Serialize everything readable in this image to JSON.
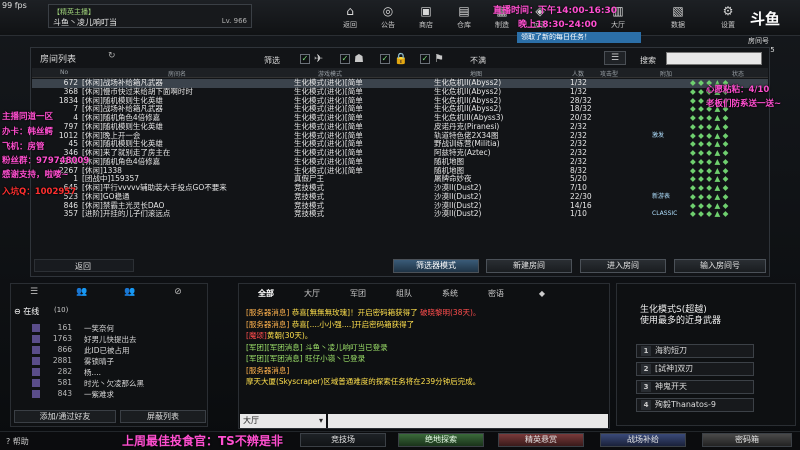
{
  "fps": "99 fps",
  "player": {
    "tag": "【精英主播】",
    "name": "斗鱼丶凌儿响叮当",
    "level": "Lv. 966"
  },
  "topnav": [
    {
      "label": "返回",
      "icon": "⌂"
    },
    {
      "label": "公告",
      "icon": "◎"
    },
    {
      "label": "商店",
      "icon": "▣"
    },
    {
      "label": "仓库",
      "icon": "▤"
    },
    {
      "label": "制造",
      "icon": "▦"
    },
    {
      "label": "运营",
      "icon": "◈"
    },
    {
      "label": "大厅",
      "icon": "▥"
    },
    {
      "label": "数据",
      "icon": "▧"
    },
    {
      "label": "设置",
      "icon": "⚙"
    }
  ],
  "stream_time_1": "直播时间：下午14:00-16:30",
  "stream_time_2": "晚上18:30-24:00",
  "mission": "领取了新的每日任务！",
  "logo": "斗鱼",
  "room_no_label": "房间号",
  "room_no": "209445",
  "room_list": {
    "title": "房间列表",
    "filter_label": "筛选",
    "full_label": "不满",
    "search_label": "搜索",
    "search_placeholder": "",
    "headers": {
      "no": "No",
      "name": "房间名",
      "mode": "游戏模式",
      "map": "地图",
      "count": "人数",
      "ping": "攻击型",
      "flag": "附加",
      "status": "状态"
    },
    "rows": [
      {
        "no": "672",
        "name": "[休闲]战场补给箱凡武器",
        "mode": "生化模式(进化)[简单",
        "map": "生化危机II(Abyss2)",
        "count": "1/32",
        "selected": true,
        "badge": ""
      },
      {
        "no": "368",
        "name": "[休闲]慢币快过来给胡下面啊时时",
        "mode": "生化模式(进化)[简单",
        "map": "生化危机II(Abyss2)",
        "count": "1/32",
        "badge": ""
      },
      {
        "no": "1834",
        "name": "[休闲]随机模则生化英雄",
        "mode": "生化模式(进化)[简单",
        "map": "生化危机II(Abyss2)",
        "count": "28/32",
        "badge": ""
      },
      {
        "no": "7",
        "name": "[休闲]战场补给箱凡武器",
        "mode": "生化模式(进化)[简单",
        "map": "生化危机II(Abyss2)",
        "count": "18/32",
        "badge": ""
      },
      {
        "no": "4",
        "name": "[休闲]随机角色4倍修嘉",
        "mode": "生化模式(进化)[简单",
        "map": "生化危机III(Abyss3)",
        "count": "20/32",
        "badge": ""
      },
      {
        "no": "797",
        "name": "[休闲]随机模则生化英雄",
        "mode": "生化模式(进化)[简单",
        "map": "皮诺丹克(Piranesi)",
        "count": "2/32",
        "badge": ""
      },
      {
        "no": "1012",
        "name": "[休闲]晚上开一会",
        "mode": "生化模式(进化)[简单",
        "map": "轨道特色佬2X34图",
        "count": "2/32",
        "badge": "激发"
      },
      {
        "no": "45",
        "name": "[休闲]随机模则生化英雄",
        "mode": "生化模式(进化)[简单",
        "map": "野战训练营(Militia)",
        "count": "2/32",
        "badge": ""
      },
      {
        "no": "346",
        "name": "[休闲]来了就别走了房主在",
        "mode": "生化模式(进化)[简单",
        "map": "阿兹特克(Aztec)",
        "count": "2/32",
        "badge": ""
      },
      {
        "no": "1145",
        "name": "[休闲]随机角色4倍修嘉",
        "mode": "生化模式(进化)[简单",
        "map": "随机地图",
        "count": "2/32",
        "badge": ""
      },
      {
        "no": "2267",
        "name": "[休闲]1338",
        "mode": "生化模式(进化)[简单",
        "map": "随机地图",
        "count": "8/32",
        "badge": ""
      },
      {
        "no": "1",
        "name": "[团战中]159357",
        "mode": "真假尸王",
        "map": "屠牌命妙夜",
        "count": "5/20",
        "badge": ""
      },
      {
        "no": "645",
        "name": "[休闲]平行vvvvv辅助装大手投点GO不要来",
        "mode": "竞技模式",
        "map": "沙漠II(Dust2)",
        "count": "7/10",
        "badge": ""
      },
      {
        "no": "523",
        "name": "[休闲]GO稳通",
        "mode": "竞技模式",
        "map": "沙漠II(Dust2)",
        "count": "22/30",
        "badge": "新游表"
      },
      {
        "no": "846",
        "name": "[休闲]禁霸主光灵长DAO",
        "mode": "竞技模式",
        "map": "沙漠II(Dust2)",
        "count": "14/16",
        "badge": ""
      },
      {
        "no": "357",
        "name": "[进阶]开挂的儿子们滚远点",
        "mode": "竞技模式",
        "map": "沙漠II(Dust2)",
        "count": "1/10",
        "badge": "CLASSIC"
      }
    ],
    "back_label": "返回",
    "btn_filter": "筛选器模式",
    "btn_new": "新建房间",
    "btn_enter": "进入房间",
    "btn_enter_no": "输入房间号"
  },
  "friends": {
    "tabs": [
      "☰",
      "👥",
      "👥",
      "⊘"
    ],
    "online_label": "在线",
    "online_count": "(10)",
    "list": [
      {
        "lv": "161",
        "name": "一笑奈何"
      },
      {
        "lv": "1763",
        "name": "好男儿快提出去"
      },
      {
        "lv": "866",
        "name": "此ID已被占用"
      },
      {
        "lv": "2881",
        "name": "雾锁晴子"
      },
      {
        "lv": "282",
        "name": "杨...."
      },
      {
        "lv": "581",
        "name": "时光丶欠凌那么黑"
      },
      {
        "lv": "843",
        "name": "一紫难求"
      }
    ],
    "add_label": "添加/通过好友",
    "block_label": "屏蔽列表"
  },
  "chat": {
    "tabs": [
      "全部",
      "大厅",
      "军团",
      "组队",
      "系统",
      "密语",
      "◆"
    ],
    "lines": [
      {
        "parts": [
          {
            "t": "[服务器消息] ",
            "c": "c-sys"
          },
          {
            "t": "恭喜[無無無玫瑰]！开启密码箱获得了 ",
            "c": "c-yel"
          },
          {
            "t": "破晓黎明(38天)。",
            "c": "c-red"
          }
        ]
      },
      {
        "parts": [
          {
            "t": "[服务器消息] ",
            "c": "c-sys"
          },
          {
            "t": "恭喜[....小小强....]开启密码箱获得了",
            "c": "c-yel"
          }
        ]
      },
      {
        "parts": [
          {
            "t": "[魔颂]",
            "c": "c-red"
          },
          {
            "t": "黄朝(30天)。",
            "c": "c-yel"
          }
        ]
      },
      {
        "parts": [
          {
            "t": "[军团][军团消息] 斗鱼丶凌儿响叮当已登录",
            "c": "c-mil"
          }
        ]
      },
      {
        "parts": [
          {
            "t": "[军团][军团消息] 旺仔小嶺丶已登录",
            "c": "c-mil"
          }
        ]
      },
      {
        "parts": [
          {
            "t": "[服务器消息]",
            "c": "c-sys"
          }
        ]
      },
      {
        "parts": [
          {
            "t": "摩天大厦(Skyscraper)区域普通难度的探索任务将在239分钟后完成。",
            "c": "c-yel"
          }
        ]
      }
    ],
    "channel": "大厅"
  },
  "promo": {
    "title": "生化模式S(超越)",
    "subtitle": "使用最多的近身武器",
    "items": [
      "海豹短刀",
      "[試神]双刃",
      "神鬼开天",
      "殉毅Thanatos-9"
    ]
  },
  "bottom": {
    "help": "帮助",
    "buttons": [
      "竞技场",
      "绝地探索",
      "精英悬赏",
      "战场补给",
      "密码箱"
    ]
  },
  "overlay": {
    "left1": "主播同道一区",
    "left2": "办卡：韩丝鳄",
    "left3": "飞机：房管",
    "left4": "粉丝群：979748009",
    "left5": "感谢支持，啦喽~",
    "left6": "入坑Q：1002957",
    "right1": "心愿粘粘：4/10",
    "right2": "老板们防系送一送~",
    "best": "上周最佳投食官：TS不辨是非"
  },
  "colors": {
    "accent": "#3a5b78",
    "overlay_pink": "#ff4fd0",
    "online_green": "#6fd06f"
  }
}
